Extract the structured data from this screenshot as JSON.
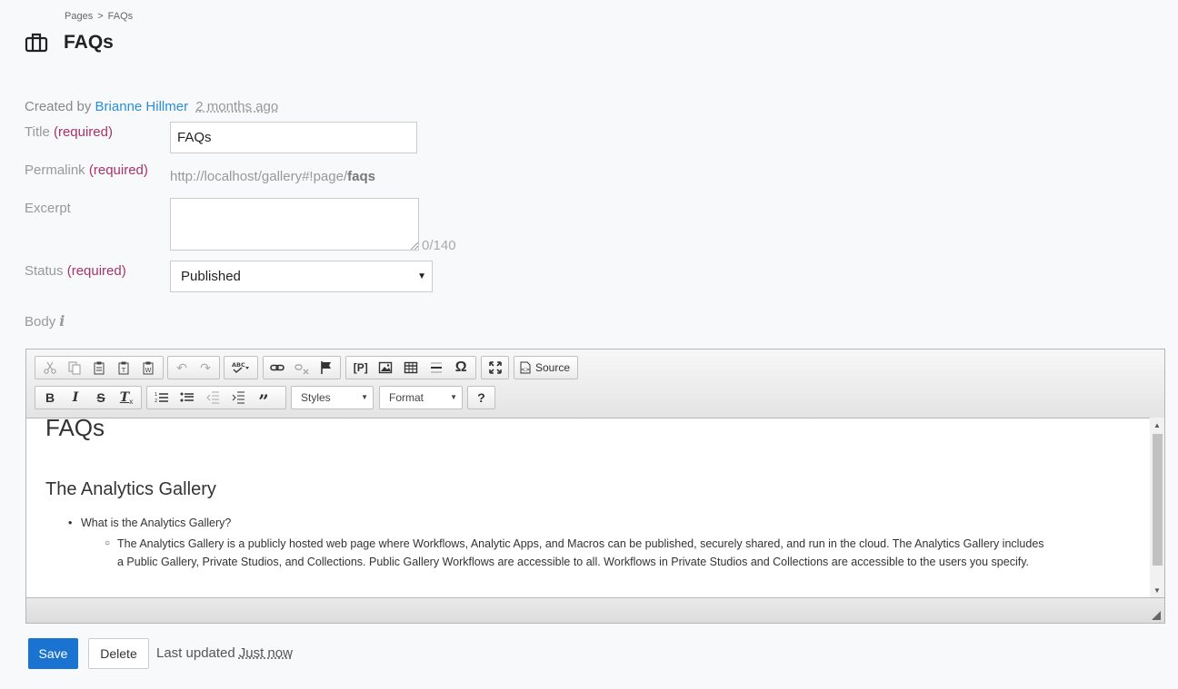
{
  "breadcrumb": {
    "root": "Pages",
    "separator": ">",
    "current": "FAQs"
  },
  "header": {
    "icon": "briefcase-icon",
    "title": "FAQs"
  },
  "meta": {
    "created_by_label": "Created by",
    "author": "Brianne Hillmer",
    "time": "2 months ago"
  },
  "form": {
    "title_label": "Title",
    "title_req": "(required)",
    "title_value": "FAQs",
    "permalink_label": "Permalink",
    "permalink_req": "(required)",
    "permalink_base": "http://localhost/gallery#!page/",
    "permalink_slug": "faqs",
    "excerpt_label": "Excerpt",
    "excerpt_value": "",
    "excerpt_counter": "0/140",
    "status_label": "Status",
    "status_req": "(required)",
    "status_value": "Published",
    "body_label": "Body",
    "body_info_icon": "info-icon"
  },
  "toolbar": {
    "styles_label": "Styles",
    "format_label": "Format",
    "source_label": "Source",
    "help_label": "?"
  },
  "editor_content": {
    "h1": "FAQs",
    "h2": "The Analytics Gallery",
    "question": "What is the Analytics Gallery?",
    "answer": "The Analytics Gallery is a publicly hosted web page where Workflows, Analytic Apps, and Macros can be published, securely shared, and run in the cloud. The Analytics Gallery includes a Public Gallery, Private Studios, and Collections. Public Gallery Workflows are accessible to all. Workflows in Private Studios and Collections are accessible to the users you specify."
  },
  "footer": {
    "save_label": "Save",
    "delete_label": "Delete",
    "updated_label": "Last updated",
    "updated_time": "Just now"
  },
  "colors": {
    "primary": "#1a73d0",
    "link": "#2a8fd6",
    "required": "#a8336b"
  }
}
